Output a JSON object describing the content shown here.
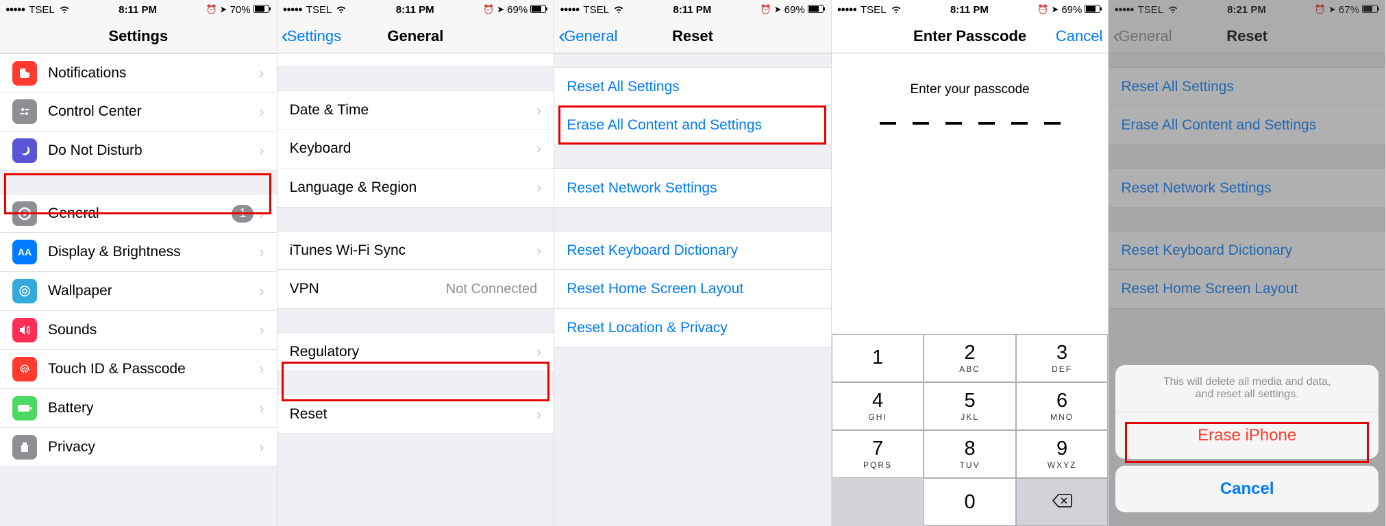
{
  "screens": [
    {
      "status": {
        "carrier": "TSEL",
        "time": "8:11 PM",
        "battery": "70%"
      },
      "nav": {
        "title": "Settings"
      },
      "rows": [
        {
          "label": "Notifications"
        },
        {
          "label": "Control Center"
        },
        {
          "label": "Do Not Disturb"
        },
        {
          "label": "General",
          "badge": "1"
        },
        {
          "label": "Display & Brightness"
        },
        {
          "label": "Wallpaper"
        },
        {
          "label": "Sounds"
        },
        {
          "label": "Touch ID & Passcode"
        },
        {
          "label": "Battery"
        },
        {
          "label": "Privacy"
        }
      ]
    },
    {
      "status": {
        "carrier": "TSEL",
        "time": "8:11 PM",
        "battery": "69%"
      },
      "nav": {
        "back": "Settings",
        "title": "General"
      },
      "rows": [
        {
          "label": "Date & Time"
        },
        {
          "label": "Keyboard"
        },
        {
          "label": "Language & Region"
        },
        {
          "label": "iTunes Wi-Fi Sync"
        },
        {
          "label": "VPN",
          "detail": "Not Connected"
        },
        {
          "label": "Regulatory"
        },
        {
          "label": "Reset"
        }
      ]
    },
    {
      "status": {
        "carrier": "TSEL",
        "time": "8:11 PM",
        "battery": "69%"
      },
      "nav": {
        "back": "General",
        "title": "Reset"
      },
      "rows": [
        {
          "label": "Reset All Settings"
        },
        {
          "label": "Erase All Content and Settings"
        },
        {
          "label": "Reset Network Settings"
        },
        {
          "label": "Reset Keyboard Dictionary"
        },
        {
          "label": "Reset Home Screen Layout"
        },
        {
          "label": "Reset Location & Privacy"
        }
      ]
    },
    {
      "status": {
        "carrier": "TSEL",
        "time": "8:11 PM",
        "battery": "69%"
      },
      "nav": {
        "title": "Enter Passcode",
        "right": "Cancel"
      },
      "prompt": "Enter your passcode",
      "keypad": [
        [
          {
            "n": "1",
            "s": ""
          },
          {
            "n": "2",
            "s": "ABC"
          },
          {
            "n": "3",
            "s": "DEF"
          }
        ],
        [
          {
            "n": "4",
            "s": "GHI"
          },
          {
            "n": "5",
            "s": "JKL"
          },
          {
            "n": "6",
            "s": "MNO"
          }
        ],
        [
          {
            "n": "7",
            "s": "PQRS"
          },
          {
            "n": "8",
            "s": "TUV"
          },
          {
            "n": "9",
            "s": "WXYZ"
          }
        ]
      ],
      "zero": "0"
    },
    {
      "status": {
        "carrier": "TSEL",
        "time": "8:21 PM",
        "battery": "67%"
      },
      "nav": {
        "back": "General",
        "title": "Reset"
      },
      "rows": [
        {
          "label": "Reset All Settings"
        },
        {
          "label": "Erase All Content and Settings"
        },
        {
          "label": "Reset Network Settings"
        },
        {
          "label": "Reset Keyboard Dictionary"
        },
        {
          "label": "Reset Home Screen Layout"
        }
      ],
      "sheet": {
        "msg": "This will delete all media and data,\nand reset all settings.",
        "destructive": "Erase iPhone",
        "cancel": "Cancel"
      }
    }
  ]
}
